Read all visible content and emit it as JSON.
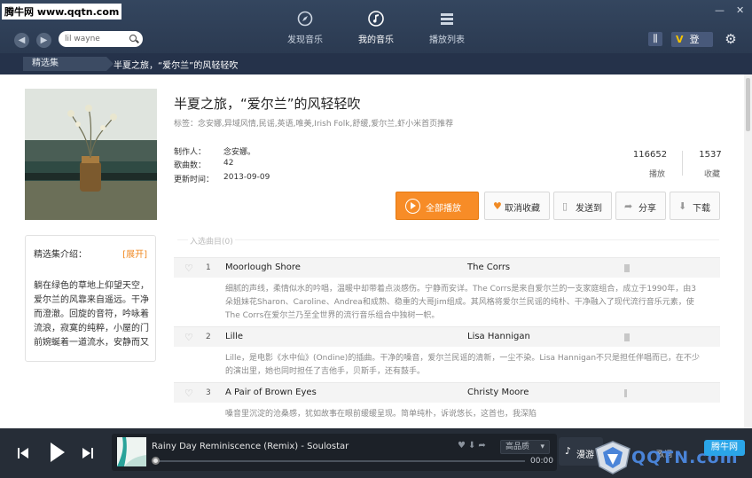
{
  "watermark": "腾牛网 www.qqtn.com",
  "search": {
    "value": "lil wayne"
  },
  "main_tabs": [
    {
      "label": "发现音乐",
      "icon": "compass-icon"
    },
    {
      "label": "我的音乐",
      "icon": "music-note-icon"
    },
    {
      "label": "播放列表",
      "icon": "list-icon"
    }
  ],
  "account": {
    "vip_badge": "V",
    "login_label": "登"
  },
  "breadcrumb": {
    "section": "精选集",
    "current": "半夏之旅，“爱尔兰”的风轻轻吹"
  },
  "playlist": {
    "title": "半夏之旅，“爱尔兰”的风轻轻吹",
    "tags": "标签：念安娜,异域风情,民谣,英语,唯美,Irish Folk,舒缓,爱尔兰,虾小米首页推荐",
    "creator_label": "制作人：",
    "creator": "念安娜。",
    "count_label": "歌曲数：",
    "count": "42",
    "updated_label": "更新时间：",
    "updated": "2013-09-09",
    "plays": "116652",
    "plays_label": "播放",
    "favorites": "1537",
    "favorites_label": "收藏"
  },
  "actions": {
    "play_all": "全部播放",
    "unfavorite": "取消收藏",
    "send_to": "发送到",
    "share": "分享",
    "download": "下载"
  },
  "intro": {
    "heading": "精选集介绍：",
    "expand": "[展开]",
    "text": "躺在绿色的草地上仰望天空，爱尔兰的风靠来自遥远。干净而澄澈。回旋的音符，吟咏着流浪，寂寞的纯粹，小屋的门前婉蜒着一道流水，安静而又"
  },
  "section_label": "入选曲目(0)",
  "songs": [
    {
      "index": "1",
      "title": "Moorlough Shore",
      "artist": "The Corrs",
      "description": "细腻的声线，柔情似水的吟唱，温暖中却带着点淡感伤。宁静而安详。The Corrs是来自爱尔兰的一支家庭组合，成立于1990年，由3朵姐妹花Sharon、Caroline、Andrea和成熟、稳重的大哥Jim组成。其风格将爱尔兰民谣的纯朴、干净融入了现代流行音乐元素，使The Corrs在爱尔兰乃至全世界的流行音乐组合中独树一帜。"
    },
    {
      "index": "2",
      "title": "Lille",
      "artist": "Lisa Hannigan",
      "description": "Lille，是电影《水中仙》(Ondine)的插曲。干净的嗓音，爱尔兰民谣的清新，一尘不染。Lisa Hannigan不只是担任伴唱而已，在不少的演出里，她也同时担任了吉他手，贝斯手，还有鼓手。"
    },
    {
      "index": "3",
      "title": "A Pair of Brown Eyes",
      "artist": "Christy Moore",
      "description": "嗓音里沉淀的沧桑感，犹如故事在眼前缓缓呈现。简单纯朴，诉说悠长，这首也，我深陷"
    }
  ],
  "player": {
    "now_playing": "Rainy Day Reminiscence (Remix) - Soulostar",
    "quality": "高品质",
    "time": "00:00",
    "progress": 0,
    "roam_label": "漫游",
    "lyrics_label": "歌词"
  },
  "brand": {
    "logo_text": "QQTN.com",
    "badge": "腾牛网"
  }
}
